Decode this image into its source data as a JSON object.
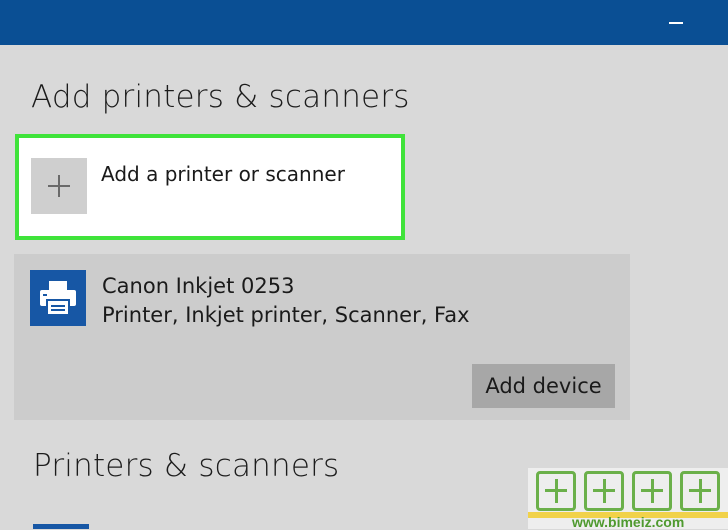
{
  "window": {
    "minimize_icon": "minimize-icon"
  },
  "add_section": {
    "title": "Add printers & scanners",
    "add_printer_label": "Add a printer or scanner",
    "add_icon": "plus-icon"
  },
  "device": {
    "name": "Canon Inkjet 0253",
    "type": "Printer, Inkjet printer, Scanner, Fax",
    "icon": "printer-icon",
    "add_device_label": "Add device"
  },
  "printers_section": {
    "title": "Printers & scanners"
  },
  "watermark": {
    "url": "www.bimeiz.com"
  },
  "colors": {
    "titlebar": "#0a4f94",
    "background": "#d9d9d9",
    "highlight": "#3fe33a",
    "device_tile": "#1757a5",
    "button": "#a7a7a7"
  }
}
